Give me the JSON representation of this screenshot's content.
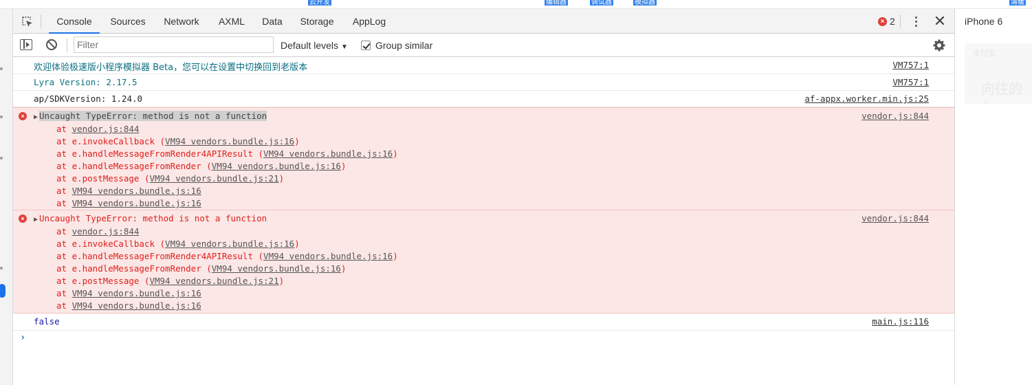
{
  "top_strip": {
    "tags": [
      "云开发",
      "编辑器",
      "调试器",
      "模拟器",
      "清缓"
    ]
  },
  "devtools": {
    "tabs": [
      "Console",
      "Sources",
      "Network",
      "AXML",
      "Data",
      "Storage",
      "AppLog"
    ],
    "active_tab": "Console",
    "error_count": "2",
    "icons": {
      "inspect": "inspect-element-icon",
      "error": "error-circle-icon",
      "more": "kebab-menu-icon",
      "close": "close-icon"
    }
  },
  "toolbar": {
    "filter_placeholder": "Filter",
    "levels_label": "Default levels",
    "group_similar_label": "Group similar",
    "group_similar_checked": true,
    "icons": {
      "sidebar": "sidebar-toggle-icon",
      "clear": "clear-console-icon",
      "settings": "gear-icon"
    }
  },
  "console": {
    "messages": [
      {
        "text": "欢迎体验极速版小程序模拟器 Beta，您可以在设置中切换回到老版本",
        "source": "VM757:1"
      },
      {
        "text": "Lyra Version: 2.17.5",
        "source": "VM757:1"
      },
      {
        "text": "ap/SDKVersion: 1.24.0",
        "source": "af-appx.worker.min.js:25"
      }
    ],
    "errors": [
      {
        "message": "Uncaught TypeError: method is not a function",
        "source": "vendor.js:844",
        "stack": [
          {
            "prefix": "at ",
            "fn": "",
            "link": "vendor.js:844"
          },
          {
            "prefix": "at ",
            "fn": "e.invokeCallback ",
            "link": "VM94 vendors.bundle.js:16"
          },
          {
            "prefix": "at ",
            "fn": "e.handleMessageFromRender4APIResult ",
            "link": "VM94 vendors.bundle.js:16"
          },
          {
            "prefix": "at ",
            "fn": "e.handleMessageFromRender ",
            "link": "VM94 vendors.bundle.js:16"
          },
          {
            "prefix": "at ",
            "fn": "e.postMessage ",
            "link": "VM94 vendors.bundle.js:21"
          },
          {
            "prefix": "at ",
            "fn": "",
            "link": "VM94 vendors.bundle.js:16"
          },
          {
            "prefix": "at ",
            "fn": "",
            "link": "VM94 vendors.bundle.js:16"
          }
        ]
      },
      {
        "message": "Uncaught TypeError: method is not a function",
        "source": "vendor.js:844",
        "stack": [
          {
            "prefix": "at ",
            "fn": "",
            "link": "vendor.js:844"
          },
          {
            "prefix": "at ",
            "fn": "e.invokeCallback ",
            "link": "VM94 vendors.bundle.js:16"
          },
          {
            "prefix": "at ",
            "fn": "e.handleMessageFromRender4APIResult ",
            "link": "VM94 vendors.bundle.js:16"
          },
          {
            "prefix": "at ",
            "fn": "e.handleMessageFromRender ",
            "link": "VM94 vendors.bundle.js:16"
          },
          {
            "prefix": "at ",
            "fn": "e.postMessage ",
            "link": "VM94 vendors.bundle.js:21"
          },
          {
            "prefix": "at ",
            "fn": "",
            "link": "VM94 vendors.bundle.js:16"
          },
          {
            "prefix": "at ",
            "fn": "",
            "link": "VM94 vendors.bundle.js:16"
          }
        ]
      }
    ],
    "last_log": {
      "text": "false",
      "source": "main.js:116"
    },
    "prompt_symbol": "›"
  },
  "phone": {
    "device_name": "iPhone 6",
    "preview_small_text": "支付宝",
    "preview_big_text": "向往的生"
  },
  "colors": {
    "error_red": "#e0201c",
    "error_bg": "#fbe7e6",
    "accent_blue": "#1a73e8",
    "teal_text": "#0b6f80"
  }
}
